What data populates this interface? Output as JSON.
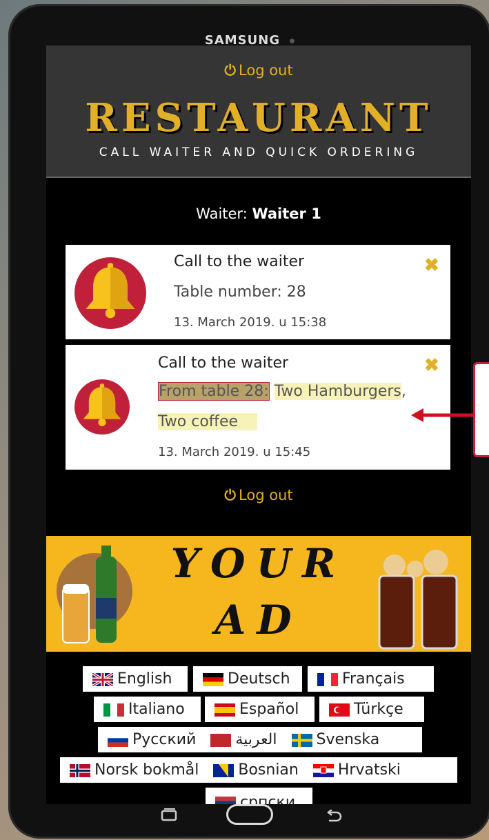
{
  "device": {
    "brand": "SAMSUNG"
  },
  "header": {
    "logout_label": "Log out",
    "title": "RESTAURANT",
    "subtitle": "CALL WAITER AND QUICK ORDERING"
  },
  "waiter": {
    "prefix": "Waiter:",
    "name": "Waiter 1"
  },
  "notifications": [
    {
      "title": "Call to the waiter",
      "detail": "Table number: 28",
      "time": "13. March 2019. u 15:38"
    },
    {
      "title": "Call to the waiter",
      "order_prefix": "From table 28:",
      "item1": "Two Hamburgers",
      "sep": ",",
      "item2": "Two coffee",
      "time": "13. March 2019. u 15:45"
    }
  ],
  "footer": {
    "logout_label": "Log out"
  },
  "ad": {
    "line1": "YOUR",
    "line2": "AD"
  },
  "languages": [
    {
      "label": "English",
      "flag": "uk-flag-icon"
    },
    {
      "label": "Deutsch",
      "flag": "germany-flag-icon"
    },
    {
      "label": "Français",
      "flag": "france-flag-icon"
    },
    {
      "label": "Italiano",
      "flag": "italy-flag-icon"
    },
    {
      "label": "Español",
      "flag": "spain-flag-icon"
    },
    {
      "label": "Türkçe",
      "flag": "turkey-flag-icon"
    },
    {
      "label": "Русский",
      "flag": "russia-flag-icon"
    },
    {
      "label": "العربية",
      "flag": "morocco-flag-icon"
    },
    {
      "label": "Svenska",
      "flag": "sweden-flag-icon"
    },
    {
      "label": "Norsk bokmål",
      "flag": "norway-flag-icon"
    },
    {
      "label": "Bosnian",
      "flag": "bosnia-flag-icon"
    },
    {
      "label": "Hrvatski",
      "flag": "croatia-flag-icon"
    },
    {
      "label": "српски",
      "flag": "serbia-flag-icon"
    }
  ],
  "colors": {
    "accent": "#e2b027",
    "bell_bg": "#c0203a",
    "header_bg": "#353535"
  }
}
